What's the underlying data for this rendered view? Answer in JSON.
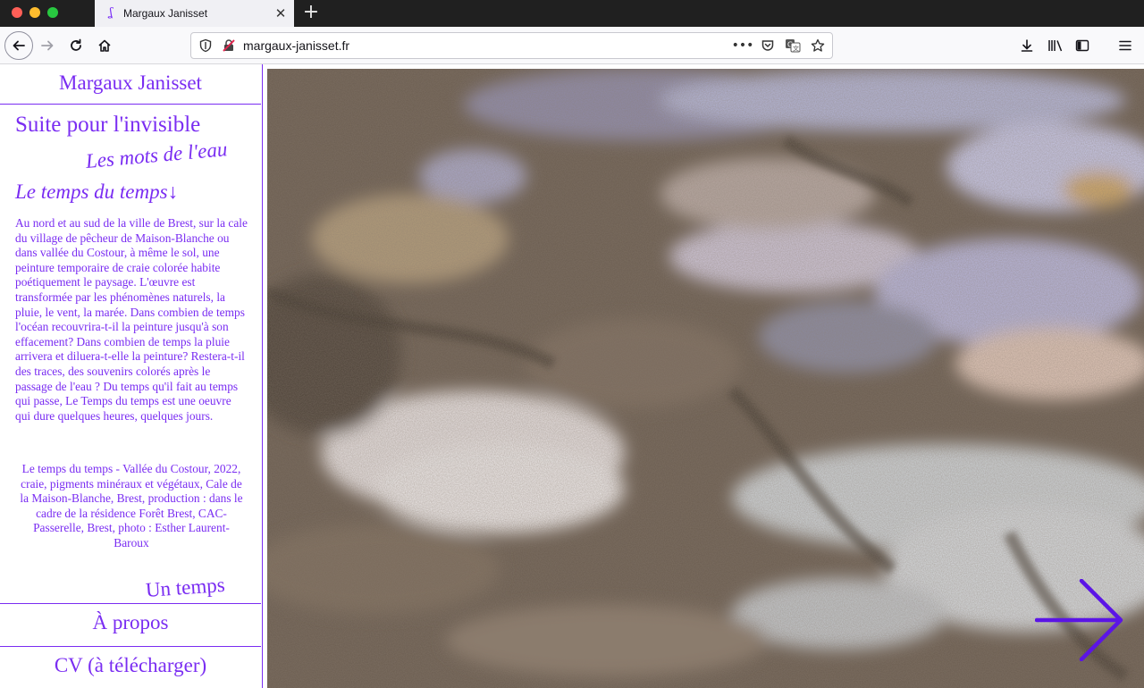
{
  "browser": {
    "tab_title": "Margaux Janisset",
    "url": "margaux-janisset.fr",
    "icons": [
      "back-arrow-icon",
      "forward-arrow-icon",
      "reload-icon",
      "home-icon",
      "shield-icon",
      "insecure-lock-icon",
      "more-dots-icon",
      "pocket-icon",
      "translate-icon",
      "bookmark-star-icon",
      "download-icon",
      "library-icon",
      "sidebar-icon",
      "menu-icon"
    ],
    "more_label": "•••"
  },
  "sidebar": {
    "site_title": "Margaux Janisset",
    "projects": [
      {
        "label": "Suite pour l'invisible"
      },
      {
        "label": "Les mots de l'eau"
      },
      {
        "label": "Le temps du temps↓"
      },
      {
        "label": "Un temps"
      }
    ],
    "description": "Au nord et au sud de la ville de Brest, sur la cale du village de pêcheur de Maison-Blanche ou dans vallée du Costour, à même le sol, une peinture temporaire de craie colorée habite poétiquement le paysage. L'œuvre est transformée par les phénomènes naturels, la pluie, le vent, la marée. Dans combien de temps l'océan recouvrira-t-il la peinture jusqu'à son effacement? Dans combien de temps la pluie arrivera et diluera-t-elle la peinture? Restera-t-il des traces, des souvenirs colorés après le passage de l'eau ? Du temps qu'il fait au temps qui passe, Le Temps du temps est une oeuvre qui dure quelques heures, quelques jours.",
    "caption": "Le temps du temps - Vallée du Costour, 2022, craie, pigments minéraux et végétaux, Cale de la Maison-Blanche, Brest, production : dans le cadre de la résidence Forêt Brest, CAC-Passerelle, Brest, photo : Esther Laurent-Baroux",
    "links": {
      "about": "À propos",
      "cv": "CV (à télécharger)"
    }
  },
  "colors": {
    "accent": "#7a2df2",
    "titlebar": "#202020",
    "toolbar": "#f9f9fb"
  },
  "photo": {
    "subject": "chalk-painting-on-ground",
    "next_icon": "right-arrow-icon"
  }
}
